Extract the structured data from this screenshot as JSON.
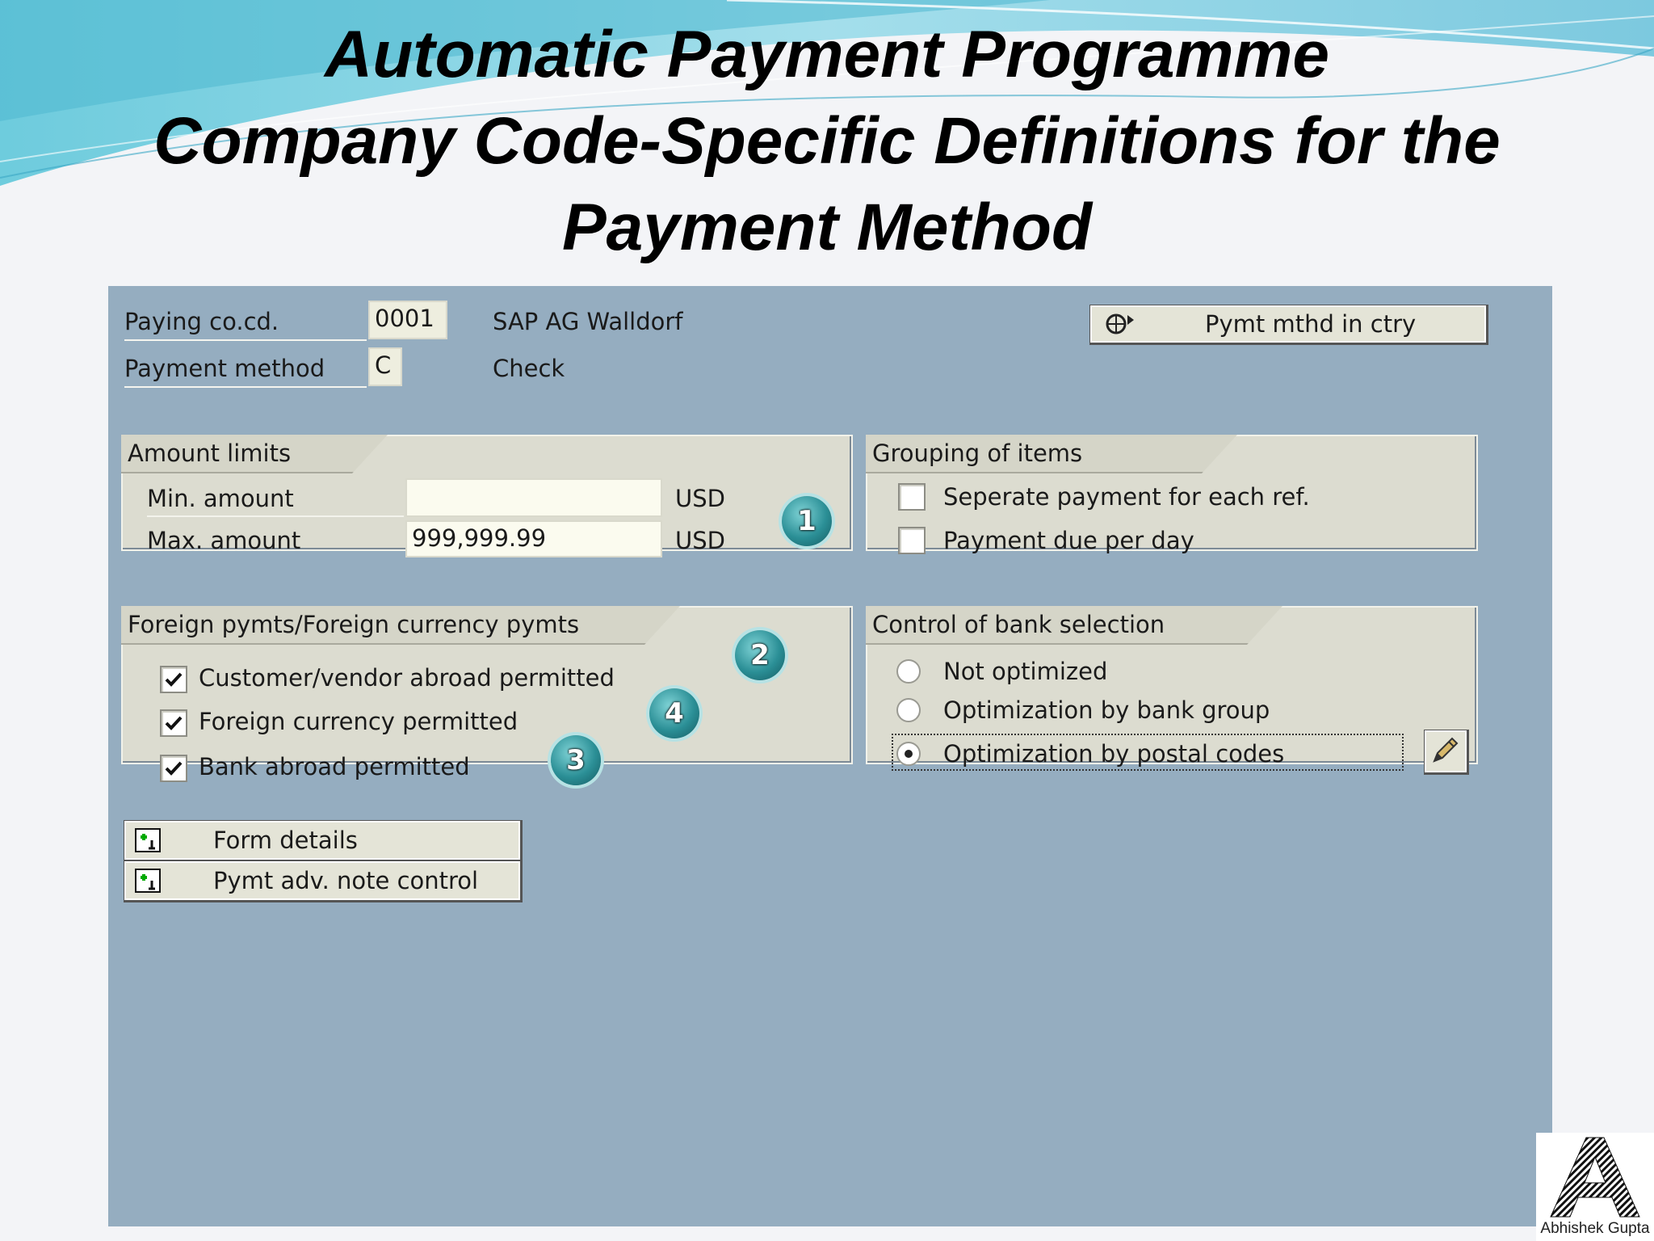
{
  "slide": {
    "title_lines": [
      "Automatic Payment Programme",
      "Company Code-Specific Definitions for the",
      "Payment Method"
    ],
    "author_logo_text": "Abhishek Gupta"
  },
  "header": {
    "paying_cocd_label": "Paying co.cd.",
    "paying_cocd_value": "0001",
    "company_name": "SAP AG Walldorf",
    "payment_method_label": "Payment method",
    "payment_method_value": "C",
    "payment_method_desc": "Check",
    "pymt_mthd_button": "Pymt mthd in ctry"
  },
  "amount_limits": {
    "title": "Amount limits",
    "min_label": "Min. amount",
    "min_value": "",
    "min_currency": "USD",
    "max_label": "Max. amount",
    "max_value": "999,999.99",
    "max_currency": "USD"
  },
  "grouping": {
    "title": "Grouping of items",
    "items": [
      {
        "label": "Seperate payment for each ref.",
        "checked": false
      },
      {
        "label": "Payment due per day",
        "checked": false
      }
    ]
  },
  "foreign": {
    "title": "Foreign pymts/Foreign currency pymts",
    "items": [
      {
        "label": "Customer/vendor abroad permitted",
        "checked": true
      },
      {
        "label": "Foreign currency permitted",
        "checked": true
      },
      {
        "label": "Bank abroad permitted",
        "checked": true
      }
    ]
  },
  "bank_selection": {
    "title": "Control of bank selection",
    "options": [
      {
        "label": "Not optimized",
        "selected": false
      },
      {
        "label": "Optimization by bank group",
        "selected": false
      },
      {
        "label": "Optimization by postal codes",
        "selected": true
      }
    ]
  },
  "buttons": {
    "form_details": "Form details",
    "pymt_adv_note": "Pymt adv. note control"
  },
  "badges": [
    "1",
    "2",
    "4",
    "3"
  ],
  "colors": {
    "sap_background": "#95adc0",
    "group_background": "#dcdcd0",
    "badge_teal": "#2b8f96"
  }
}
